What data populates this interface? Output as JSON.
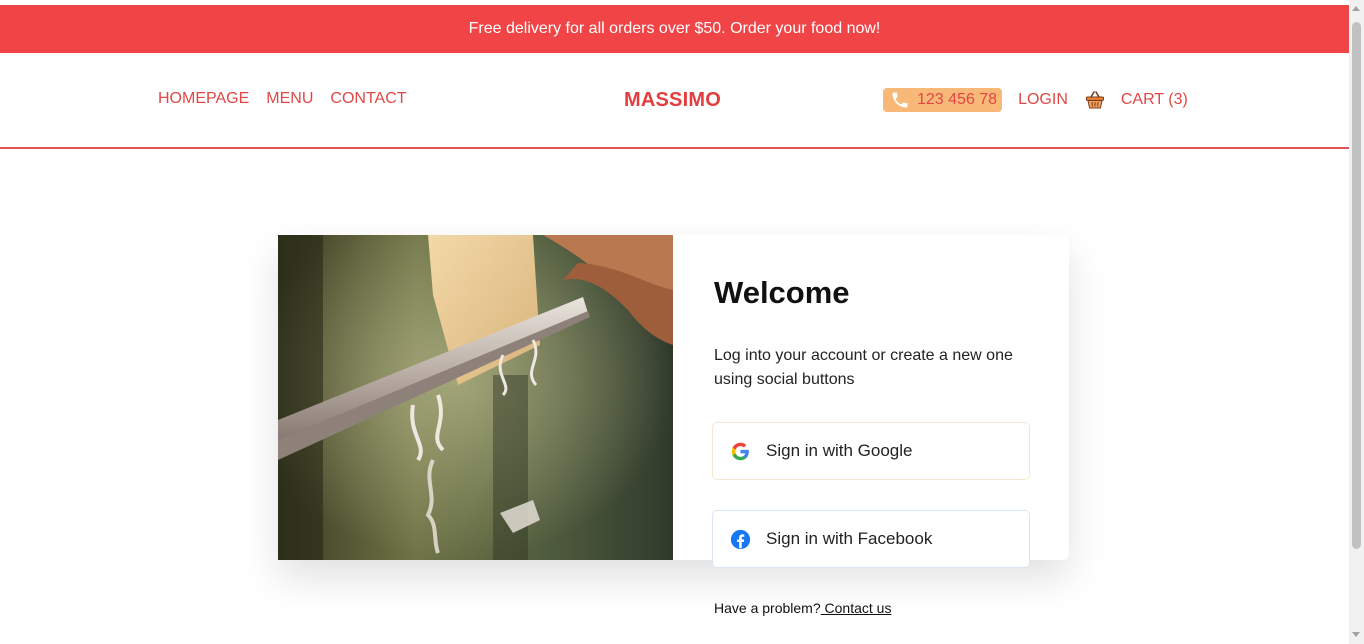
{
  "promo": {
    "text": "Free delivery for all orders over $50. Order your food now!"
  },
  "nav": {
    "left": [
      "HOMEPAGE",
      "MENU",
      "CONTACT"
    ],
    "logo": "MASSIMO",
    "phone": "123 456 78",
    "login": "LOGIN",
    "cart": "CART (3)"
  },
  "login_card": {
    "title": "Welcome",
    "description": "Log into your account or create a new one using social buttons",
    "google_label": "Sign in with Google",
    "facebook_label": "Sign in with Facebook"
  },
  "footer": {
    "problem_text": "Have a problem?",
    "contact_link": " Contact us"
  },
  "colors": {
    "brand_red": "#f04446",
    "accent_orange": "#f8b877",
    "facebook_blue": "#1877f2"
  },
  "icons": [
    "phone-icon",
    "basket-icon",
    "google-icon",
    "facebook-icon"
  ]
}
